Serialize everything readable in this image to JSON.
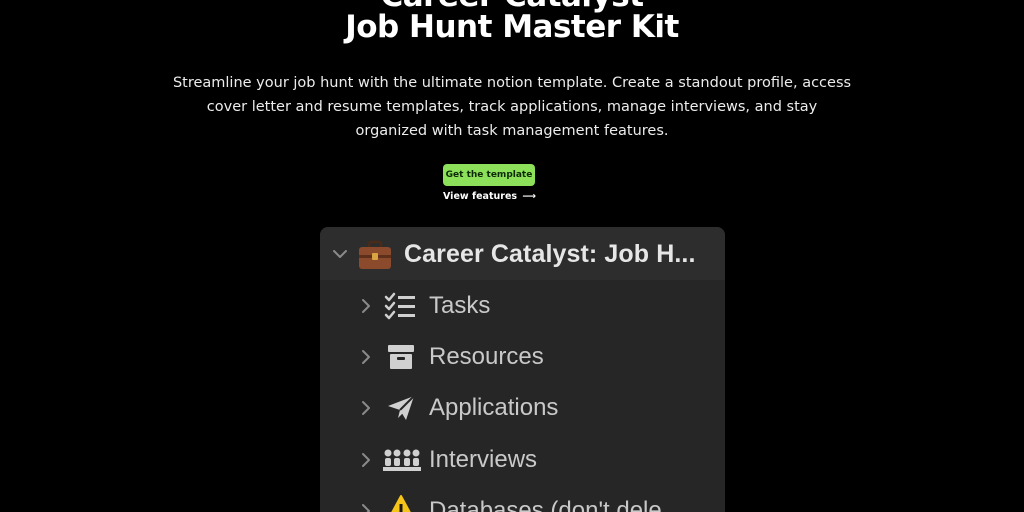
{
  "hero": {
    "title_line1": "Career Catalyst",
    "title_line2": "Job Hunt Master Kit",
    "description_line1": "Streamline your job hunt with the ultimate notion template. Create a standout profile, access",
    "description_line2": "cover letter and resume templates, track applications, manage interviews, and stay",
    "description_line3": "organized with task management features.",
    "cta_label": "Get the template",
    "secondary_link": "View features",
    "secondary_arrow": "⟶"
  },
  "sidebar": {
    "root": {
      "label": "Career Catalyst: Job H...",
      "icon": "briefcase-icon",
      "expanded": true
    },
    "items": [
      {
        "label": "Tasks",
        "icon": "checklist-icon"
      },
      {
        "label": "Resources",
        "icon": "archive-box-icon"
      },
      {
        "label": "Applications",
        "icon": "paper-plane-icon"
      },
      {
        "label": "Interviews",
        "icon": "group-meeting-icon"
      },
      {
        "label": "Databases (don't dele",
        "icon": "warning-icon"
      }
    ]
  },
  "colors": {
    "background": "#000000",
    "accent": "#8de05a",
    "panel": "#262626",
    "panel_header": "#2d2d2d",
    "warning": "#f5c518",
    "briefcase": "#8b4a2b"
  }
}
